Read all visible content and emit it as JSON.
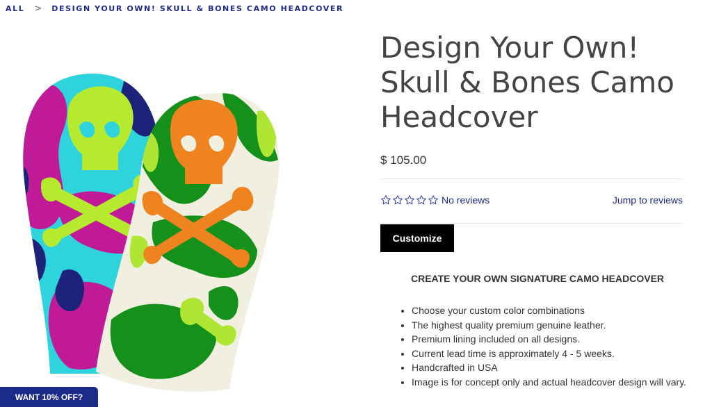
{
  "breadcrumb": {
    "items": [
      "ALL",
      "DESIGN YOUR OWN! SKULL & BONES CAMO HEADCOVER"
    ],
    "separator": ">"
  },
  "product": {
    "title": "Design Your Own! Skull & Bones Camo Headcover",
    "price": "$ 105.00",
    "rating": {
      "stars": 5,
      "filled": 0,
      "no_reviews_label": "No reviews",
      "jump_label": "Jump to reviews"
    },
    "customize_label": "Customize",
    "description_heading": "CREATE YOUR OWN SIGNATURE CAMO HEADCOVER",
    "features": [
      "Choose your custom color combinations",
      "The highest quality premium genuine leather.",
      "Premium lining included on all designs.",
      "Current lead time is approximately 4 - 5 weeks.",
      "Handcrafted in USA",
      "Image is for concept only and actual headcover design will vary."
    ]
  },
  "promo": {
    "label": "WANT 10% OFF?"
  },
  "colors": {
    "link": "#1f2a8a",
    "button": "#000000",
    "promo_bg": "#1c2a8a",
    "cover1_base": "#2ed3dc",
    "cover1_camo_a": "#c01a98",
    "cover1_camo_b": "#1d237a",
    "cover1_skull": "#b6ea2e",
    "cover2_base": "#f1efdf",
    "cover2_camo": "#14901b",
    "cover2_skull": "#ee8320",
    "cover2_accent": "#aee633"
  }
}
